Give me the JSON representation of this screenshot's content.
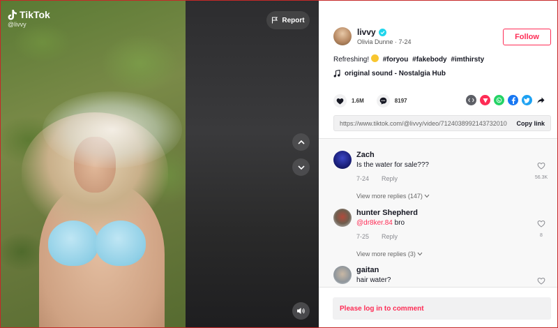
{
  "video": {
    "brand": "TikTok",
    "handle": "@livvy",
    "report_label": "Report"
  },
  "author": {
    "username": "livvy",
    "display_name": "Olivia Dunne",
    "date": "7-24",
    "follow_label": "Follow"
  },
  "caption": {
    "text": "Refreshing!",
    "hashtags": [
      "#foryou",
      "#fakebody",
      "#imthirsty"
    ]
  },
  "music": "original sound - Nostalgia Hub",
  "stats": {
    "likes": "1.6M",
    "comments": "8197"
  },
  "share": {
    "url": "https://www.tiktok.com/@livvy/video/7124038992143732010",
    "copy_label": "Copy link"
  },
  "comments": [
    {
      "name": "Zach",
      "text": "Is the water for sale???",
      "mention": "",
      "date": "7-24",
      "reply_label": "Reply",
      "likes": "56.3K",
      "view_more": "View more replies (147)",
      "avatar_color": "#1a1f7a"
    },
    {
      "name": "hunter Shepherd",
      "text": "bro",
      "mention": "@dr8ker.84",
      "date": "7-25",
      "reply_label": "Reply",
      "likes": "8",
      "view_more": "View more replies (3)",
      "avatar_color": "#8a7a6a"
    },
    {
      "name": "gaitan",
      "text": "hair water?",
      "mention": "",
      "date": "",
      "reply_label": "",
      "likes": "",
      "view_more": "",
      "avatar_color": "#9aa0a6"
    }
  ],
  "login_prompt": "Please log in to comment",
  "colors": {
    "accent": "#fe2c55",
    "verified": "#20d5ec"
  }
}
